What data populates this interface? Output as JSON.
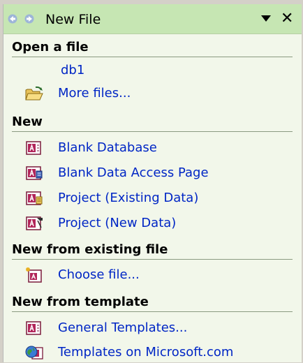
{
  "pane": {
    "title": "New File"
  },
  "sections": {
    "open": {
      "heading": "Open a file",
      "items": [
        "db1",
        "More files..."
      ]
    },
    "new": {
      "heading": "New",
      "items": [
        "Blank Database",
        "Blank Data Access Page",
        "Project (Existing Data)",
        "Project (New Data)"
      ]
    },
    "existing": {
      "heading": "New from existing file",
      "items": [
        "Choose file..."
      ]
    },
    "template": {
      "heading": "New from template",
      "items": [
        "General Templates...",
        "Templates on Microsoft.com"
      ]
    }
  },
  "icons": {
    "back": "back-arrow-icon",
    "forward": "forward-arrow-icon",
    "dropdown": "chevron-down-icon",
    "close": "close-icon",
    "folder": "open-folder-icon",
    "access": "access-database-icon",
    "page": "data-access-page-icon",
    "project_existing": "project-existing-icon",
    "project_new": "project-new-icon",
    "choose": "new-from-existing-icon",
    "templates": "templates-icon",
    "globe": "globe-icon"
  },
  "colors": {
    "pane_bg": "#f2f7ea",
    "titlebar_bg": "#c6e6b3",
    "link": "#0026c5"
  }
}
